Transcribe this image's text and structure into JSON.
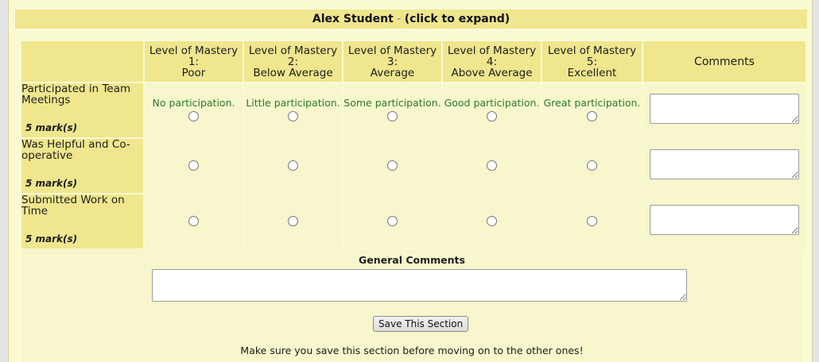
{
  "header": {
    "student_name": "Alex Student",
    "separator": " - ",
    "expand_label": "(click to expand)"
  },
  "rubric": {
    "levels": [
      {
        "line1": "Level of Mastery",
        "line2": "1:",
        "line3": "Poor"
      },
      {
        "line1": "Level of Mastery",
        "line2": "2:",
        "line3": "Below Average"
      },
      {
        "line1": "Level of Mastery",
        "line2": "3:",
        "line3": "Average"
      },
      {
        "line1": "Level of Mastery",
        "line2": "4:",
        "line3": "Above Average"
      },
      {
        "line1": "Level of Mastery",
        "line2": "5:",
        "line3": "Excellent"
      }
    ],
    "comments_header": "Comments",
    "criteria": [
      {
        "name": "Participated in Team Meetings",
        "marks": "5 mark(s)",
        "descriptions": [
          "No participation.",
          "Little participation.",
          "Some participation.",
          "Good participation.",
          "Great participation."
        ],
        "comment": ""
      },
      {
        "name": "Was Helpful and Co-operative",
        "marks": "5 mark(s)",
        "descriptions": [
          "",
          "",
          "",
          "",
          ""
        ],
        "comment": ""
      },
      {
        "name": "Submitted Work on Time",
        "marks": "5 mark(s)",
        "descriptions": [
          "",
          "",
          "",
          "",
          ""
        ],
        "comment": ""
      }
    ]
  },
  "general": {
    "title": "General Comments",
    "value": "",
    "save_label": "Save This Section",
    "note": "Make sure you save this section before moving on to the other ones!"
  }
}
